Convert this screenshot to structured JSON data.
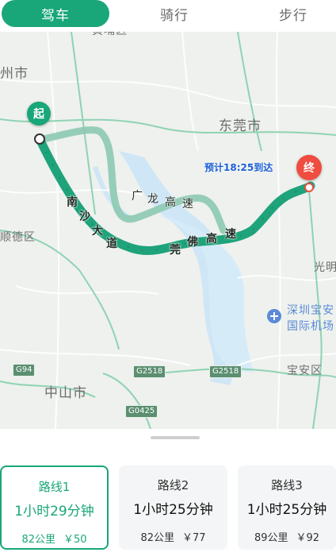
{
  "mode_tabs": [
    "驾车",
    "骑行",
    "步行"
  ],
  "map": {
    "labels": {
      "top_partial": "黄埔区",
      "left_city": "州市",
      "dongguan": "东莞市",
      "shunde": "顺德区",
      "guangming": "光明",
      "airport": "深圳宝安",
      "airport2": "国际机场",
      "baoan": "宝安区",
      "zhongshan": "中山市"
    },
    "shields": [
      "G94",
      "G2518",
      "G2518",
      "G0425"
    ],
    "start_marker": "起",
    "end_marker": "终",
    "eta": "预计18:25到达",
    "road_names": {
      "nansha": [
        "南",
        "沙",
        "大",
        "道"
      ],
      "guanglong": [
        "广",
        "龙",
        "高",
        "速"
      ],
      "guanfo": [
        "莞",
        "佛",
        "高",
        "速"
      ]
    }
  },
  "routes": [
    {
      "name": "路线1",
      "duration": "1小时29分钟",
      "distance": "82公里",
      "price": "￥50"
    },
    {
      "name": "路线2",
      "duration": "1小时25分钟",
      "distance": "82公里",
      "price": "￥77"
    },
    {
      "name": "路线3",
      "duration": "1小时25分钟",
      "distance": "89公里",
      "price": "￥92"
    }
  ],
  "colors": {
    "accent": "#19a679",
    "route": "#1ea37a",
    "alt_route": "#8cc9b2",
    "end_pin": "#ee4d40",
    "eta": "#1a5fd6"
  }
}
